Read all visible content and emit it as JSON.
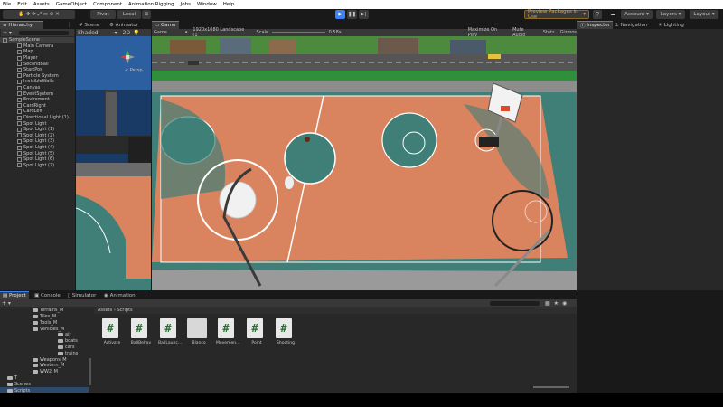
{
  "menu": [
    "File",
    "Edit",
    "Assets",
    "GameObject",
    "Component",
    "Animation Rigging",
    "Jobs",
    "Window",
    "Help"
  ],
  "toolbar": {
    "pivot": "Pivot",
    "local": "Local",
    "preview_packages": "Preview Packages in Use",
    "account": "Account",
    "layers": "Layers",
    "layout": "Layout"
  },
  "hierarchy": {
    "tab": "Hierarchy",
    "items": [
      {
        "label": "SampleScene",
        "depth": 0
      },
      {
        "label": "Main Camera",
        "depth": 1
      },
      {
        "label": "Map",
        "depth": 1
      },
      {
        "label": "Player",
        "depth": 1
      },
      {
        "label": "SecondBall",
        "depth": 1
      },
      {
        "label": "StartPos",
        "depth": 1
      },
      {
        "label": "Particle System",
        "depth": 1
      },
      {
        "label": "InvisibleWalls",
        "depth": 1
      },
      {
        "label": "Canvas",
        "depth": 1
      },
      {
        "label": "EventSystem",
        "depth": 1
      },
      {
        "label": "Enviroment",
        "depth": 1
      },
      {
        "label": "CardRight",
        "depth": 1
      },
      {
        "label": "CardLeft",
        "depth": 1
      },
      {
        "label": "Directional Light (1)",
        "depth": 1
      },
      {
        "label": "Spot Light",
        "depth": 1
      },
      {
        "label": "Spot Light (1)",
        "depth": 1
      },
      {
        "label": "Spot Light (2)",
        "depth": 1
      },
      {
        "label": "Spot Light (3)",
        "depth": 1
      },
      {
        "label": "Spot Light (4)",
        "depth": 1
      },
      {
        "label": "Spot Light (5)",
        "depth": 1
      },
      {
        "label": "Spot Light (6)",
        "depth": 1
      },
      {
        "label": "Spot Light (7)",
        "depth": 1
      }
    ]
  },
  "scene": {
    "tab_scene": "Scene",
    "tab_animator": "Animator",
    "shading": "Shaded",
    "mode_2d": "2D",
    "persp": "< Persp"
  },
  "game": {
    "tab": "Game",
    "display": "Game",
    "resolution": "1920x1080 Landscape (1",
    "scale_label": "Scale",
    "scale_value": "0.58x",
    "maximize": "Maximize On Play",
    "mute": "Mute Audio",
    "stats": "Stats",
    "gizmos": "Gizmos"
  },
  "right_tabs": {
    "inspector": "Inspector",
    "navigation": "Navigation",
    "lighting": "Lighting"
  },
  "bottom_tabs": {
    "project": "Project",
    "console": "Console",
    "simulator": "Simulator",
    "animation": "Animation"
  },
  "project": {
    "folders": [
      {
        "label": "Terrains_M",
        "depth": 1
      },
      {
        "label": "Tiles_M",
        "depth": 1
      },
      {
        "label": "Tools_M",
        "depth": 1
      },
      {
        "label": "Vehicles_M",
        "depth": 1
      },
      {
        "label": "air",
        "depth": 2
      },
      {
        "label": "boats",
        "depth": 2
      },
      {
        "label": "cars",
        "depth": 2
      },
      {
        "label": "trains",
        "depth": 2
      },
      {
        "label": "Weapons_M",
        "depth": 1
      },
      {
        "label": "Western_M",
        "depth": 1
      },
      {
        "label": "WW2_M",
        "depth": 1
      },
      {
        "label": "T",
        "depth": 0
      },
      {
        "label": "Scenes",
        "depth": 0
      },
      {
        "label": "Scripts",
        "depth": 0
      }
    ],
    "breadcrumb_root": "Assets",
    "breadcrumb_sep": "›",
    "breadcrumb_current": "Scripts",
    "files": [
      {
        "label": "Activate",
        "type": "script",
        "glyph": "#"
      },
      {
        "label": "BallBehav",
        "type": "script",
        "glyph": "#"
      },
      {
        "label": "BallLaunc...",
        "type": "script",
        "glyph": "#"
      },
      {
        "label": "Blanco",
        "type": "asset",
        "glyph": ""
      },
      {
        "label": "Movemen...",
        "type": "script",
        "glyph": "#"
      },
      {
        "label": "Point",
        "type": "script",
        "glyph": "#"
      },
      {
        "label": "Shooting",
        "type": "script",
        "glyph": "#"
      }
    ]
  },
  "colors": {
    "court": "#d9835f",
    "court_border": "#3f7f78",
    "grass": "#2f8f3a",
    "accent_blue": "#3b82f6"
  }
}
